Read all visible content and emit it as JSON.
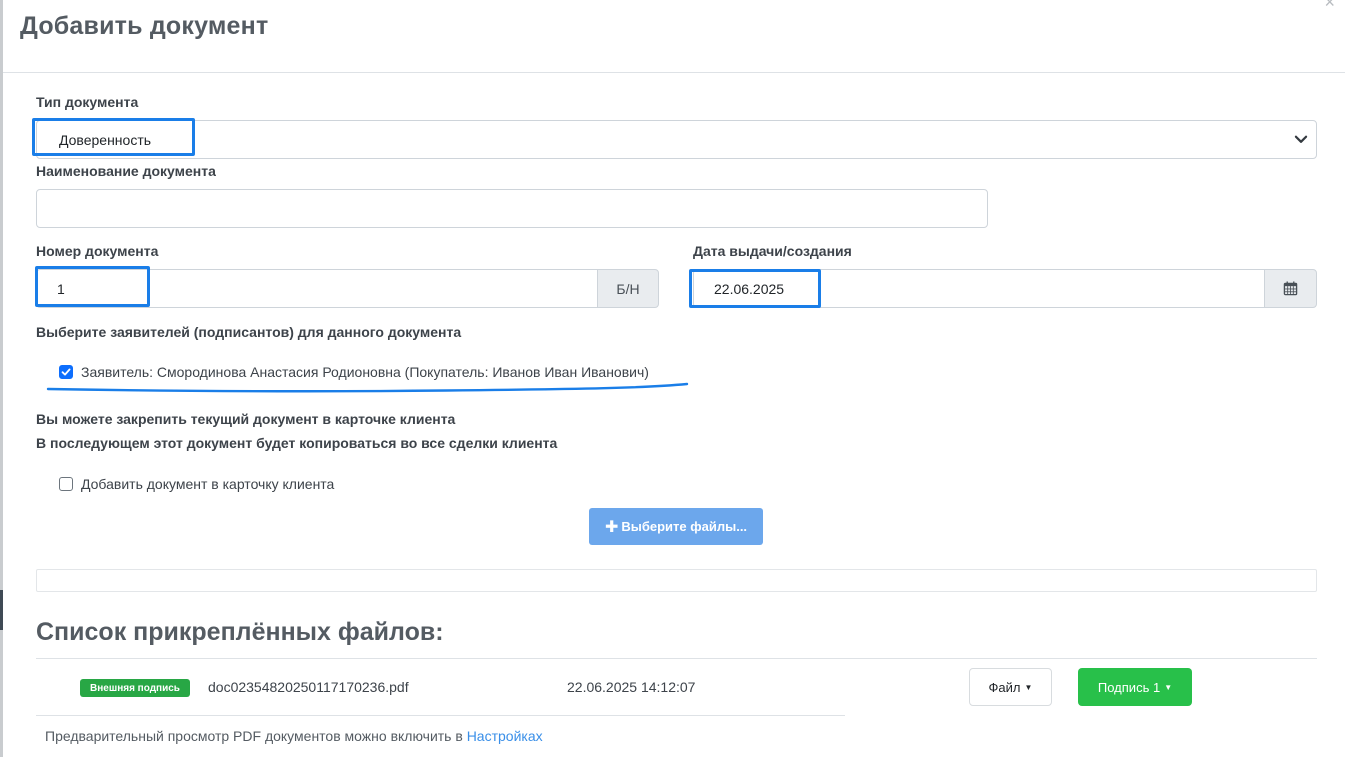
{
  "modal": {
    "title": "Добавить документ",
    "close_symbol": "×"
  },
  "doc_type": {
    "label": "Тип документа",
    "value": "Доверенность",
    "icon": "chevron-down-icon"
  },
  "doc_name": {
    "label": "Наименование документа",
    "value": ""
  },
  "doc_number": {
    "label": "Номер документа",
    "value": "1",
    "addon": "Б/Н"
  },
  "issue_date": {
    "label": "Дата выдачи/создания",
    "value": "22.06.2025",
    "icon": "calendar-icon"
  },
  "signers": {
    "label": "Выберите заявителей (подписантов) для данного документа",
    "items": [
      {
        "label": "Заявитель: Смородинова Анастасия Родионовна (Покупатель: Иванов Иван Иванович)",
        "checked": true
      }
    ]
  },
  "pin": {
    "line1": "Вы можете закрепить текущий документ в карточке клиента",
    "line2": "В последующем этот документ будет копироваться во все сделки клиента",
    "checkbox_label": "Добавить документ в карточку клиента",
    "checked": false
  },
  "upload": {
    "button_label": "Выберите файлы...",
    "icon": "plus-icon"
  },
  "files": {
    "title": "Список прикреплённых файлов:",
    "rows": [
      {
        "badge": "Внешняя подпись",
        "filename": "doc02354820250117170236.pdf",
        "datetime": "22.06.2025 14:12:07",
        "file_button": "Файл",
        "sign_button": "Подпись 1"
      }
    ]
  },
  "footer": {
    "note": "Предварительный просмотр PDF документов можно включить в",
    "link": "Настройках"
  },
  "colors": {
    "highlight": "#1a7ee8",
    "upload_button": "#6ca7ec",
    "badge_green": "#28a745",
    "sign_button_green": "#28c04a",
    "link": "#3a8fe8"
  }
}
